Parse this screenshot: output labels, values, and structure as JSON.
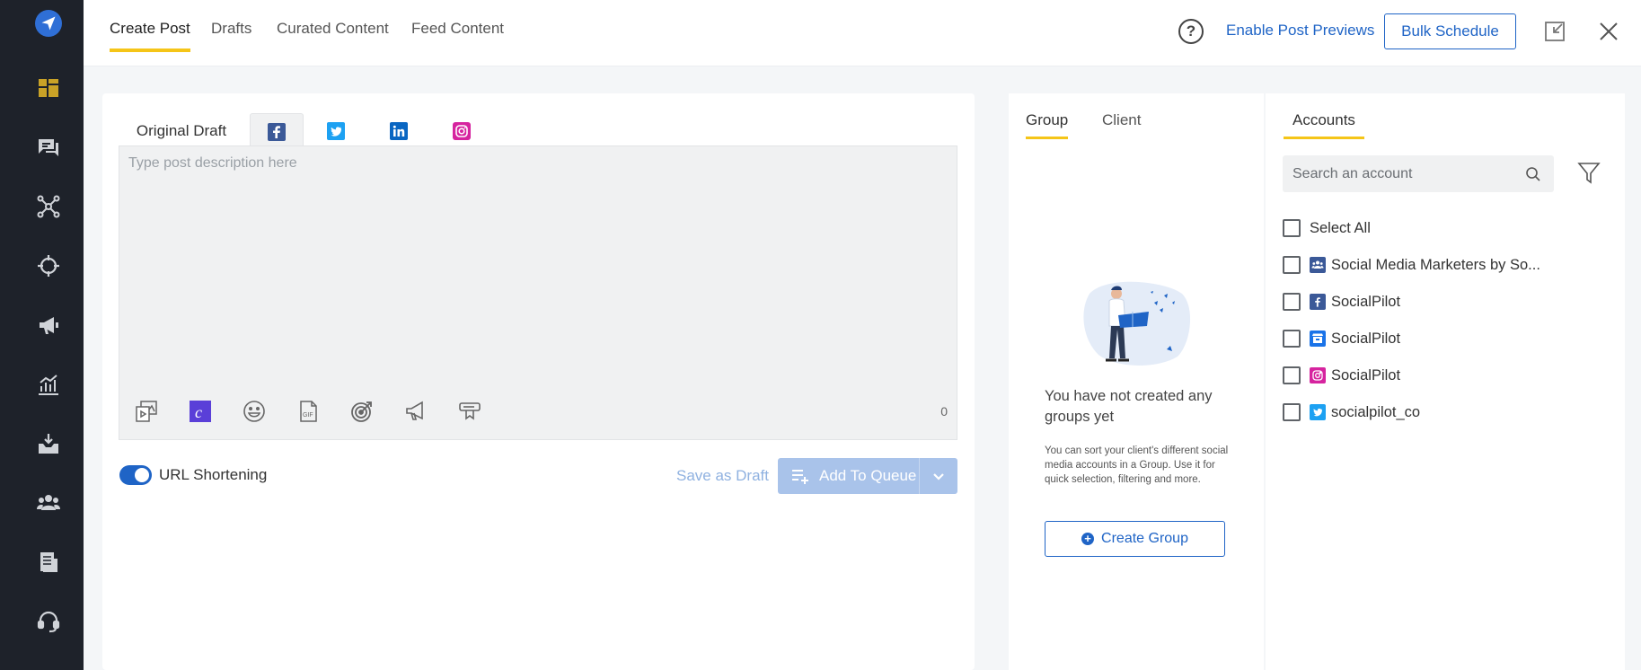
{
  "topbar": {
    "tabs": [
      "Create Post",
      "Drafts",
      "Curated Content",
      "Feed Content"
    ],
    "active_tab": "Create Post",
    "help_label": "?",
    "enable_previews": "Enable Post Previews",
    "bulk_schedule": "Bulk Schedule"
  },
  "sidebar": {
    "items": [
      "dashboard-icon",
      "inbox-icon",
      "connections-icon",
      "target-icon",
      "campaign-icon",
      "analytics-icon",
      "download-icon",
      "team-icon",
      "posts-icon",
      "support-icon"
    ]
  },
  "composer": {
    "tabs": [
      "Original Draft",
      "facebook-icon",
      "twitter-icon",
      "linkedin-icon",
      "instagram-icon"
    ],
    "placeholder": "Type post description here",
    "tools": [
      "media-icon",
      "canva-icon",
      "emoji-icon",
      "gif-icon",
      "targeting-icon",
      "campaign-icon",
      "hashtag-icon"
    ],
    "char_count": "0",
    "url_shortening": "URL Shortening",
    "url_shortening_on": true,
    "save_draft": "Save as Draft",
    "add_to_queue": "Add To Queue"
  },
  "groups": {
    "tabs": [
      "Group",
      "Client"
    ],
    "active_tab": "Group",
    "empty_title": "You have not created any groups yet",
    "empty_desc": "You can sort your client's different social media accounts in a Group. Use it for quick selection, filtering and more.",
    "create_group": "Create Group"
  },
  "accounts": {
    "tab": "Accounts",
    "search_placeholder": "Search an account",
    "select_all": "Select All",
    "items": [
      {
        "label": "Social Media Marketers by So...",
        "network": "facebook-group",
        "color": "#3b5998"
      },
      {
        "label": "SocialPilot",
        "network": "facebook",
        "color": "#3b5998"
      },
      {
        "label": "SocialPilot",
        "network": "google-business",
        "color": "#1a73e8"
      },
      {
        "label": "SocialPilot",
        "network": "instagram",
        "color": "#d6249f"
      },
      {
        "label": "socialpilot_co",
        "network": "twitter",
        "color": "#1da1f2"
      }
    ]
  },
  "colors": {
    "accent": "#1f64c6",
    "tab_underline": "#f5c518",
    "rail": "#1e222a",
    "rail_active": "#c9a227"
  }
}
